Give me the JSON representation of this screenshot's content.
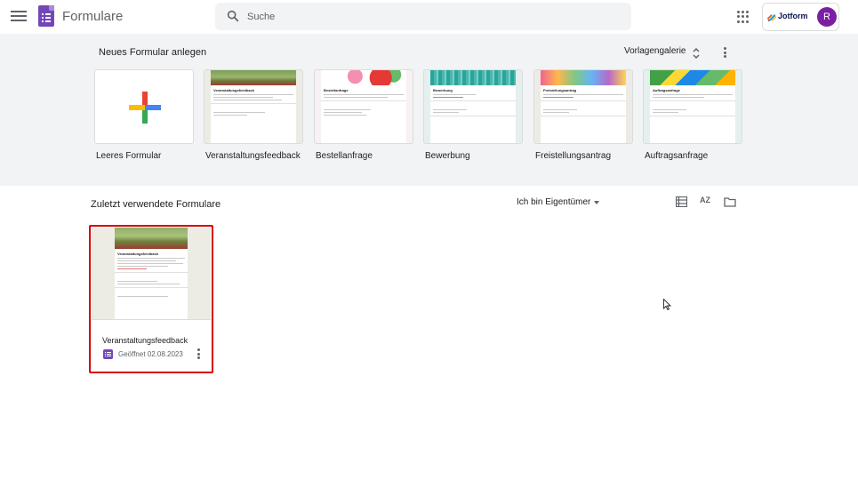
{
  "header": {
    "app_title": "Formulare",
    "search_placeholder": "Suche",
    "account_brand": "Jotform",
    "avatar_letter": "R"
  },
  "gallery": {
    "title": "Neues Formular anlegen",
    "toggle_label": "Vorlagengalerie",
    "templates": [
      {
        "label": "Leeres Formular"
      },
      {
        "label": "Veranstaltungsfeedback"
      },
      {
        "label": "Bestellanfrage"
      },
      {
        "label": "Bewerbung"
      },
      {
        "label": "Freistellungsantrag"
      },
      {
        "label": "Auftragsanfrage"
      }
    ],
    "thumb_titles": [
      "Veranstaltungsfeedback",
      "Bestellanfrage",
      "Bewerbung",
      "Freistellungsantrag",
      "Auftragsanfrage"
    ]
  },
  "recent": {
    "title": "Zuletzt verwendete Formulare",
    "owner_filter": "Ich bin Eigentümer",
    "sort_icon_text": "AZ",
    "doc": {
      "name": "Veranstaltungsfeedback",
      "opened": "Geöffnet 02.08.2023",
      "thumb_title": "Veranstaltungsfeedback"
    }
  },
  "colors": {
    "brand_purple": "#7248b9",
    "highlight_red": "#d50000",
    "gallery_bg": "#f1f3f4"
  },
  "icons": [
    "menu-icon",
    "forms-logo-icon",
    "search-icon",
    "apps-icon",
    "jotform-icon",
    "unfold-icon",
    "more-vert-icon",
    "list-view-icon",
    "sort-az-icon",
    "folder-icon",
    "form-type-icon",
    "mouse-cursor-icon"
  ]
}
